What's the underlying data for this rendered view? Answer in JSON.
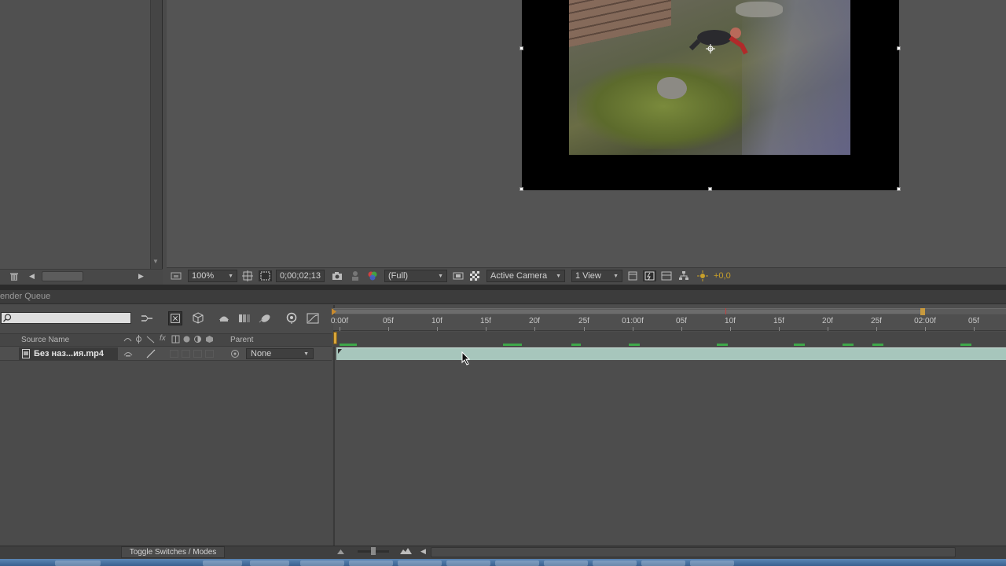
{
  "project": {
    "trash_icon": "trash-icon"
  },
  "viewer_toolbar": {
    "zoom": "100%",
    "timecode": "0;00;02;13",
    "resolution": "(Full)",
    "camera": "Active Camera",
    "views": "1 View",
    "exposure": "+0,0"
  },
  "tabs": {
    "render_queue": "ender Queue"
  },
  "timeline": {
    "columns": {
      "source_name": "Source Name",
      "parent": "Parent"
    },
    "layer": {
      "name": "Без наз...ия.mp4",
      "parent": "None"
    },
    "ruler_ticks": [
      "0:00f",
      "05f",
      "10f",
      "15f",
      "20f",
      "25f",
      "01:00f",
      "05f",
      "10f",
      "15f",
      "20f",
      "25f",
      "02:00f",
      "05f"
    ],
    "toggle_label": "Toggle Switches / Modes"
  },
  "colors": {
    "layer_bar": "#a7c6bc",
    "cache": "#3ea84a",
    "cti": "#d9a73b",
    "exposure_text": "#c8a02a"
  }
}
